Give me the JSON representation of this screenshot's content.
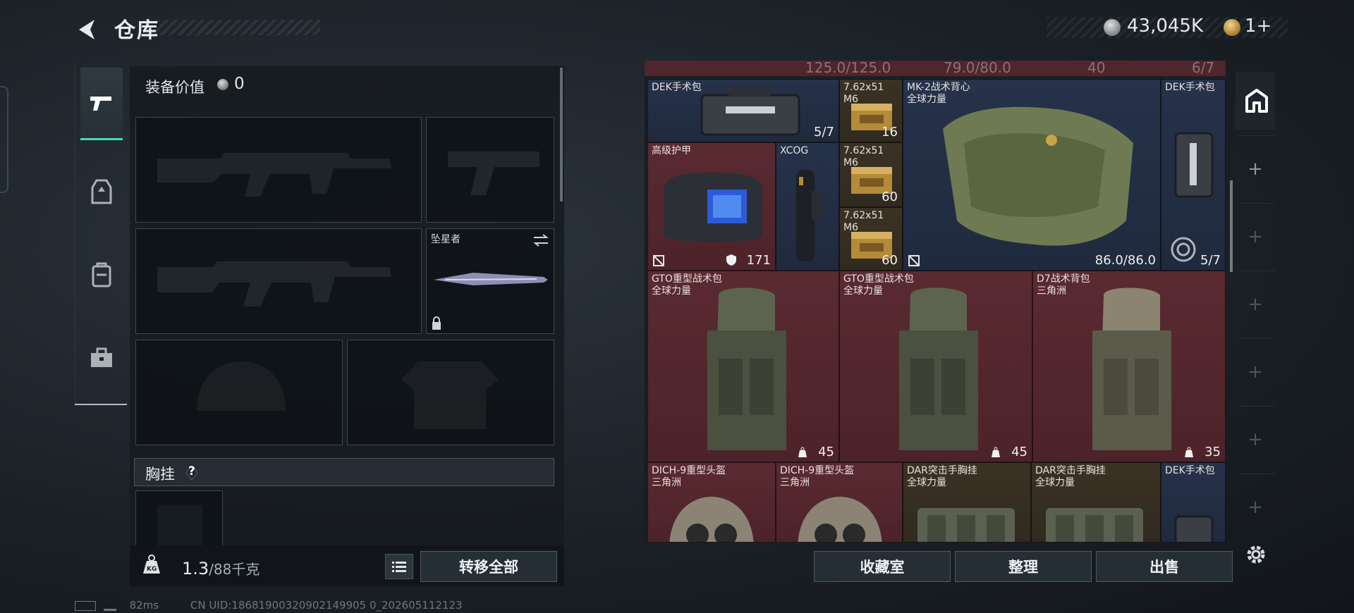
{
  "header": {
    "title": "仓库",
    "silver_amount": "43,045K",
    "gold_amount": "1+"
  },
  "equipment": {
    "value_label": "装备价值",
    "value": "0",
    "melee_name": "坠星者",
    "chest_title": "胸挂",
    "help_label": "?",
    "weight_current": "1.3",
    "weight_max": "/88千克",
    "transfer_all": "转移全部"
  },
  "storage": {
    "top_values": [
      "125.0/125.0",
      "79.0/80.0",
      "40",
      "6/7"
    ],
    "items": [
      {
        "name": "DEK手术包",
        "sub": "",
        "count": "5/7"
      },
      {
        "name": "7.62x51",
        "sub": "M6",
        "count": "16"
      },
      {
        "name": "MK-2战术背心",
        "sub": "全球力量",
        "count": "86.0/86.0"
      },
      {
        "name": "DEK手术包",
        "sub": "",
        "count": "5/7"
      },
      {
        "name": "高级护甲",
        "sub": "",
        "count": "171"
      },
      {
        "name": "XCOG",
        "sub": "",
        "count": ""
      },
      {
        "name": "7.62x51",
        "sub": "M6",
        "count": "60"
      },
      {
        "name": "7.62x51",
        "sub": "M6",
        "count": "60"
      },
      {
        "name": "GTO重型战术包",
        "sub": "全球力量",
        "count": "45"
      },
      {
        "name": "GTO重型战术包",
        "sub": "全球力量",
        "count": "45"
      },
      {
        "name": "D7战术背包",
        "sub": "三角洲",
        "count": "35"
      },
      {
        "name": "DICH-9重型头盔",
        "sub": "三角洲",
        "count": ""
      },
      {
        "name": "DICH-9重型头盔",
        "sub": "三角洲",
        "count": ""
      },
      {
        "name": "DAR突击手胸挂",
        "sub": "全球力量",
        "count": ""
      },
      {
        "name": "DAR突击手胸挂",
        "sub": "全球力量",
        "count": ""
      },
      {
        "name": "DEK手术包",
        "sub": "",
        "count": ""
      }
    ]
  },
  "actions": {
    "collection": "收藏室",
    "organize": "整理",
    "sell": "出售"
  },
  "status": {
    "ping": "82ms",
    "uid": "CN UID:18681900320902149905 0_202605112123"
  },
  "colors": {
    "accent": "#3de2b1",
    "red_cell": "#5a2a31",
    "blue_cell": "#26324a",
    "gold_cell": "#3b3224"
  }
}
